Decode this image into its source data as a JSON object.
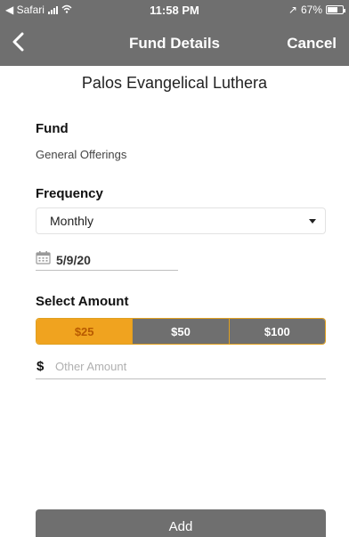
{
  "status_bar": {
    "back_app": "◀ Safari",
    "time": "11:58 PM",
    "location_arrow": "↗",
    "battery": "67%"
  },
  "nav": {
    "title": "Fund Details",
    "cancel_label": "Cancel"
  },
  "organization": "Palos Evangelical Luthera",
  "fund": {
    "label": "Fund",
    "value": "General Offerings"
  },
  "frequency": {
    "label": "Frequency",
    "selected": "Monthly"
  },
  "start_date": "5/9/20",
  "amount": {
    "label": "Select Amount",
    "options": [
      "$25",
      "$50",
      "$100"
    ],
    "selected": "$25",
    "currency_symbol": "$",
    "other_placeholder": "Other Amount"
  },
  "add_label": "Add",
  "colors": {
    "bar": "#6f6f6f",
    "accent": "#f0a31f",
    "accent_text": "#b85a00"
  }
}
